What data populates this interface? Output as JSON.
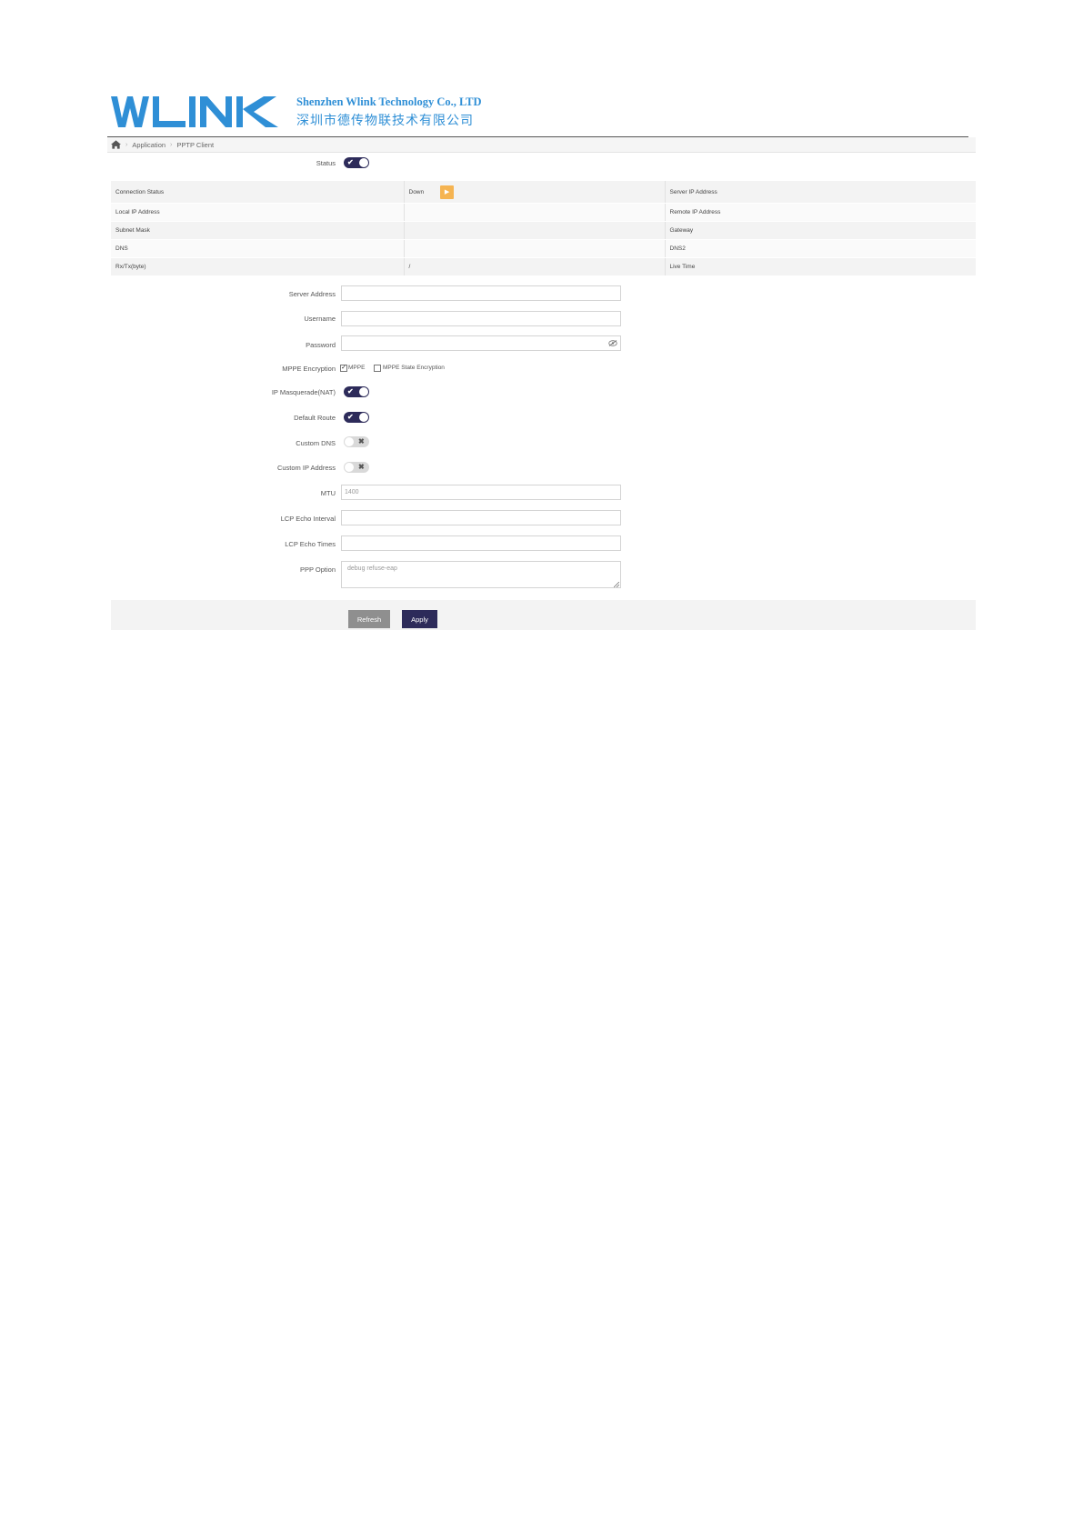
{
  "header": {
    "company_en": "Shenzhen Wlink Technology Co., LTD",
    "company_cn": "深圳市德传物联技术有限公司",
    "logo_icon": "wlink-logo"
  },
  "breadcrumb": {
    "home_icon": "home-icon",
    "items": [
      "Application",
      "PPTP Client"
    ],
    "separator": "›"
  },
  "status_toggle": {
    "label": "Status",
    "on": true
  },
  "status_table": {
    "rows": [
      {
        "label": "Connection Status",
        "value": "Down",
        "right_label": "Server IP Address",
        "right_value": ""
      },
      {
        "label": "Local IP Address",
        "value": "",
        "right_label": "Remote IP Address",
        "right_value": ""
      },
      {
        "label": "Subnet Mask",
        "value": "",
        "right_label": "Gateway",
        "right_value": ""
      },
      {
        "label": "DNS",
        "value": "",
        "right_label": "DNS2",
        "right_value": ""
      },
      {
        "label": "Rx/Tx(byte)",
        "value": "/",
        "right_label": "Live Time",
        "right_value": ""
      }
    ],
    "status_color": "#f5b452"
  },
  "form": {
    "server_address": {
      "label": "Server Address",
      "value": ""
    },
    "username": {
      "label": "Username",
      "value": ""
    },
    "password": {
      "label": "Password",
      "value": ""
    },
    "mppe": {
      "label": "MPPE Encryption",
      "mppe_label": "MPPE",
      "mppe_checked": true,
      "state_label": "MPPE State Encryption",
      "state_checked": false
    },
    "nat": {
      "label": "IP Masquerade(NAT)",
      "on": true
    },
    "default_route": {
      "label": "Default Route",
      "on": true
    },
    "custom_dns": {
      "label": "Custom DNS",
      "on": false
    },
    "custom_ip": {
      "label": "Custom IP Address",
      "on": false
    },
    "mtu": {
      "label": "MTU",
      "value": "1400"
    },
    "lcp_interval": {
      "label": "LCP Echo Interval",
      "value": ""
    },
    "lcp_times": {
      "label": "LCP Echo Times",
      "value": ""
    },
    "ppp_option": {
      "label": "PPP Option",
      "placeholder": "debug refuse-eap"
    }
  },
  "buttons": {
    "refresh": "Refresh",
    "apply": "Apply"
  },
  "colors": {
    "primary": "#2d2b5a",
    "brand": "#2f8fd6"
  }
}
